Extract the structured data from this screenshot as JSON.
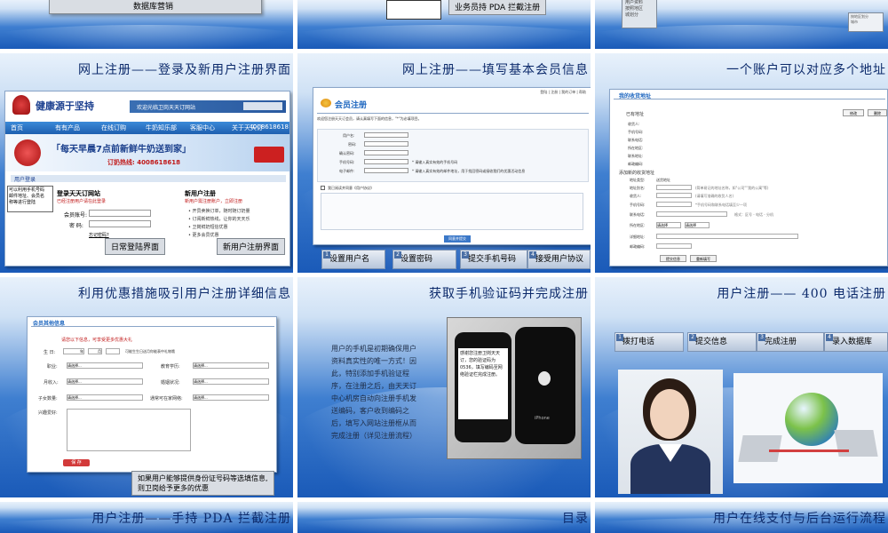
{
  "slides": {
    "top_left": {
      "label": "数据库营销"
    },
    "top_mid": {
      "label": "业务员持 PDA 拦截注册"
    },
    "top_right": {
      "label": "用户资料\n按照地区\n城划分",
      "small": "按地区划分\n城市"
    },
    "row1_left": {
      "title": "网上注册——登录及新用户注册界面",
      "brand": "健康源于坚持",
      "welcome": "欢迎光临卫岗天天订网站",
      "nav": [
        "首页",
        "有有产品",
        "在线订购",
        "牛奶知乐部",
        "客服中心",
        "关于天天订"
      ],
      "phone_top": "4008618618",
      "banner": "「每天早晨7点前新鲜牛奶送到家」",
      "hotline": "订奶热线: 4008618618",
      "section": "用户登录",
      "note": "可以利用手机号码\n邮件地址、会员名\n称等进行登陆",
      "login_title": "登录天天订网站",
      "login_hint": "已经注册用户请在此登录",
      "account_label": "会员账号:",
      "password_label": "密 码:",
      "forgot": "忘记密码?",
      "reg_title": "新用户注册",
      "reg_hint": "新用户需注册账户，立即注册",
      "reg_items": [
        "• 开员卖换订单，随时随订奶量",
        "• 订阅新鲜热线，让你的天天乐",
        "• 卫岗鲜奶短信优惠",
        "• 更多会员优惠"
      ],
      "caption_left": "日常登陆界面",
      "caption_right": "新用户注册界面"
    },
    "row1_mid": {
      "title": "网上注册——填写基本会员信息",
      "header": "会员注册",
      "top_links": "登陆 | 注册 | 我的订单 | 帮助",
      "intro": "欢迎您注册天天订会员，请认真填写下面的信息，\"*\"为必填项目。",
      "fields": [
        "用户名:",
        "密码:",
        "确认密码:",
        "手机号码:",
        "电子邮件:"
      ],
      "hint1": "* 请输入真实有效的手机号码",
      "hint2": "* 请输入真实有效的邮件地址，用于找回密码或接收我们的优惠活动信息",
      "agree": "我已阅读并同意《用户协议》",
      "submit": "同意并提交",
      "steps": [
        "设置用户名",
        "设置密码",
        "提交手机号码",
        "接受用户协议"
      ]
    },
    "row1_right": {
      "title": "一个账户可以对应多个地址",
      "header": "我的收货地址",
      "section1": "已有地址",
      "edit": "修改",
      "delete": "删除",
      "fields1": [
        "收货人:",
        "手机号码:",
        "联系电话:",
        "所在地区:",
        "联系地址:",
        "邮政编码:"
      ],
      "section2": "添加新的收货地址",
      "fields2": [
        "地址类型:",
        "地址别名:",
        "收货人:",
        "手机号码:",
        "联系电话:",
        "所在地区:",
        "详细地址:",
        "邮政编码:"
      ],
      "v_type": "送货地址",
      "hint_alias": "(简单易记的地址名称，如\"公司\"\"我的公寓\"等)",
      "hint_name": "(请填写准确的收货人名)",
      "hint_phone": "*手机号码和联系电话填至少一项",
      "hint_tel": "格式：区号 - 电话 - 分机",
      "select": "请选择",
      "submit": "提交信息",
      "reset": "重新填写"
    },
    "row2_left": {
      "title": "利用优惠措施吸引用户注册详细信息",
      "header": "会员其他信息",
      "tip": "请您以下信息，可享受更多优惠大礼",
      "birthday_label": "生 日:",
      "year": "年",
      "month": "月",
      "birthday_hint": "可能生生日送月你能表中礼物哦",
      "fields_left": [
        "职业:",
        "月收入:",
        "子女数量:"
      ],
      "fields_right": [
        "教育学历:",
        "婚姻状况:",
        "通常可在家网络:"
      ],
      "select": "请选择...",
      "interest_label": "兴趣爱好:",
      "save": "保 存",
      "caption": "如果用户能够提供身份证号码等选填信息,\n则卫岗给予更多的优惠"
    },
    "row2_mid": {
      "title": "获取手机验证码并完成注册",
      "body": "用户的手机是初期确保用户资料真实性的唯一方式！因此，特别添加手机验证程序，在注册之后，由天天订中心机房自动向注册手机发送编码，客户收到编码之后，填写入网站注册框从而完成注册（详见注册流程）",
      "sms": "感谢您注册卫岗天天订，您的验证码为0536，填写编码至网络验证栏完成注册。",
      "phone_brand": "iPhone"
    },
    "row2_right": {
      "title": "用户注册—— 400 电话注册",
      "steps": [
        "拨打电话",
        "提交信息",
        "完成注册",
        "录入数据库"
      ]
    },
    "row3_left": {
      "title": "用户注册——手持 PDA 拦截注册"
    },
    "row3_mid": {
      "title": "目录"
    },
    "row3_right": {
      "title": "用户在线支付与后台运行流程"
    }
  }
}
